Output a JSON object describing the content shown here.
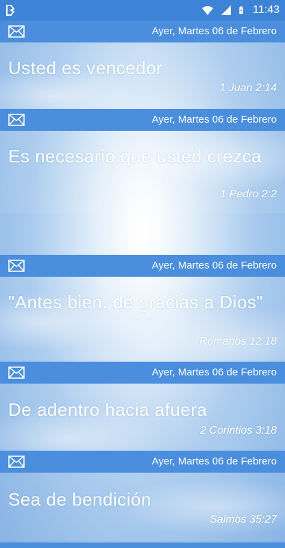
{
  "status_bar": {
    "time": "11:43",
    "icons": [
      "app-notification-icon",
      "wifi-icon",
      "cell-signal-icon",
      "battery-charging-icon"
    ]
  },
  "messages": [
    {
      "date": "Ayer, Martes 06 de Febrero",
      "title": "Usted es vencedor",
      "reference": "1 Juan 2:14"
    },
    {
      "date": "Ayer, Martes 06 de Febrero",
      "title": "Es necesario que usted crezca",
      "reference": "1 Pedro 2:2"
    },
    {
      "date": "Ayer, Martes 06 de Febrero",
      "title": "\"Antes bien, dé gracias a Dios\"",
      "reference": "Romanos 12:18"
    },
    {
      "date": "Ayer, Martes 06 de Febrero",
      "title": "De adentro hacia afuera",
      "reference": "2 Corintios 3:18"
    },
    {
      "date": "Ayer, Martes 06 de Febrero",
      "title": "Sea de bendición",
      "reference": "Salmos 35:27"
    }
  ],
  "colors": {
    "header_bar": "#4a8edd",
    "status_bar": "#3e84d6",
    "text": "#ffffff"
  }
}
